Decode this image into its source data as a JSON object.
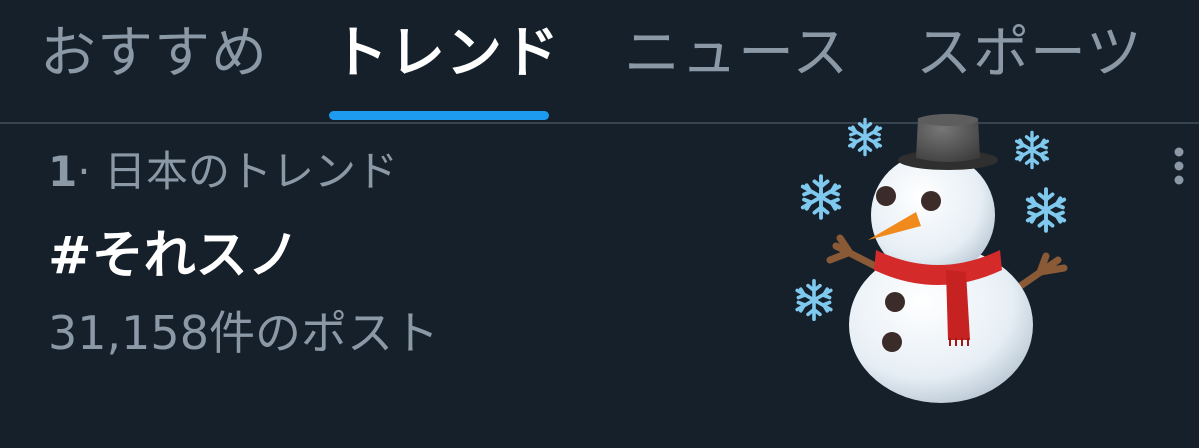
{
  "tabs": [
    {
      "label": "おすすめ",
      "active": false
    },
    {
      "label": "トレンド",
      "active": true
    },
    {
      "label": "ニュース",
      "active": false
    },
    {
      "label": "スポーツ",
      "active": false
    }
  ],
  "trend": {
    "rank": "1",
    "separator": "·",
    "category": "日本のトレンド",
    "name": "#それスノ",
    "post_count": "31,158件のポスト",
    "image_icon": "snowman-emoji",
    "more_icon": "more-vertical-icon"
  },
  "colors": {
    "background": "#15202b",
    "accent": "#1d9bf0",
    "text_primary": "#ffffff",
    "text_secondary": "#8b98a5",
    "divider": "#38444d"
  }
}
